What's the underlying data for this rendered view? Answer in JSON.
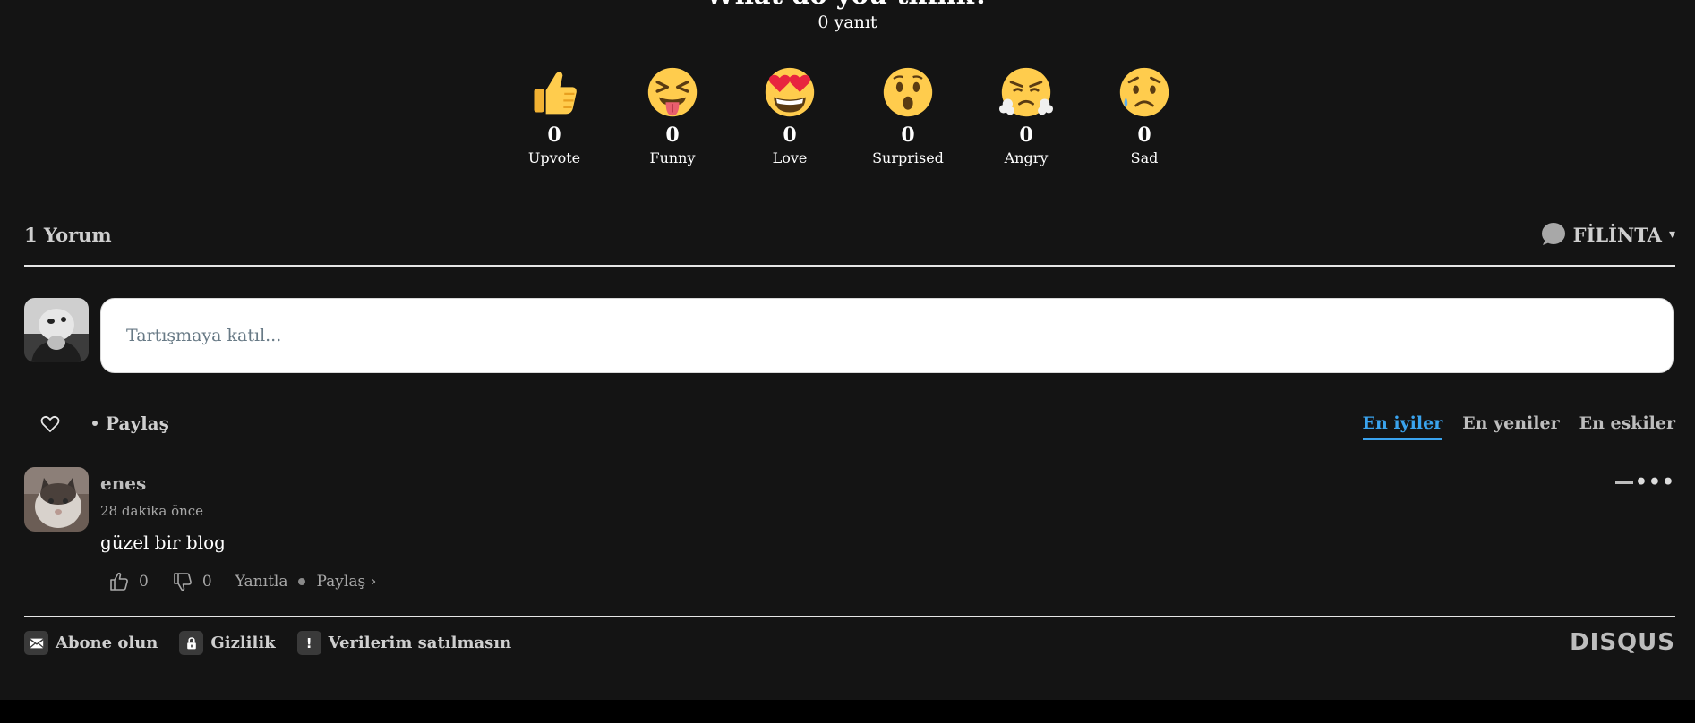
{
  "reactions_header": {
    "title": "What do you think?",
    "responses": "0 yanıt"
  },
  "reactions": [
    {
      "icon": "thumbs-up-emoji-icon",
      "count": "0",
      "label": "Upvote"
    },
    {
      "icon": "tongue-out-emoji-icon",
      "count": "0",
      "label": "Funny"
    },
    {
      "icon": "heart-eyes-emoji-icon",
      "count": "0",
      "label": "Love"
    },
    {
      "icon": "surprised-emoji-icon",
      "count": "0",
      "label": "Surprised"
    },
    {
      "icon": "angry-emoji-icon",
      "count": "0",
      "label": "Angry"
    },
    {
      "icon": "sad-emoji-icon",
      "count": "0",
      "label": "Sad"
    }
  ],
  "thread": {
    "comment_count": "1 Yorum",
    "community_name": "FİLİNTA",
    "caret": "▾"
  },
  "composer": {
    "placeholder": "Tartışmaya katıl..."
  },
  "actions": {
    "share_label": "Paylaş"
  },
  "sort": {
    "tabs": [
      "En iyiler",
      "En yeniler",
      "En eskiler"
    ],
    "active": "En iyiler"
  },
  "comments": [
    {
      "author": "enes",
      "time": "28 dakika önce",
      "text": "güzel bir blog",
      "upvotes": "0",
      "downvotes": "0",
      "reply_label": "Yanıtla",
      "share_label": "Paylaş ›",
      "more_label": "•••"
    }
  ],
  "footer": {
    "subscribe": "Abone olun",
    "privacy": "Gizlilik",
    "do_not_sell": "Verilerim satılmasın",
    "brand": "DISQUS",
    "icons": [
      "mail-icon",
      "lock-icon",
      "exclamation-icon"
    ]
  },
  "colors": {
    "background": "#141414",
    "accent": "#3aa3ee",
    "text": "#e6e6e6"
  }
}
